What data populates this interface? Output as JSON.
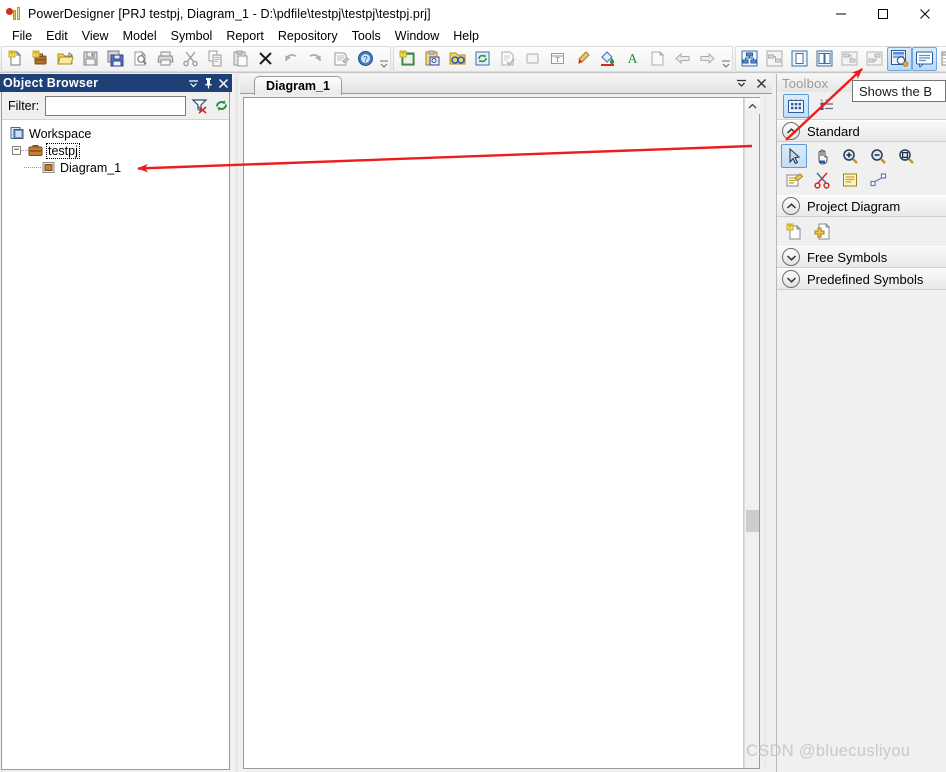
{
  "window": {
    "title": "PowerDesigner [PRJ testpj, Diagram_1 - D:\\pdfile\\testpj\\testpj\\testpj.prj]",
    "app_icon": "powerdesigner-icon",
    "controls": {
      "minimize": "minimize-icon",
      "maximize": "maximize-icon",
      "close": "close-icon"
    }
  },
  "menubar": {
    "items": [
      {
        "label": "File"
      },
      {
        "label": "Edit"
      },
      {
        "label": "View"
      },
      {
        "label": "Model"
      },
      {
        "label": "Symbol"
      },
      {
        "label": "Report"
      },
      {
        "label": "Repository"
      },
      {
        "label": "Tools"
      },
      {
        "label": "Window"
      },
      {
        "label": "Help"
      }
    ]
  },
  "toolbar": {
    "group1": [
      {
        "name": "new-icon"
      },
      {
        "name": "new-project-icon"
      },
      {
        "name": "open-icon"
      },
      {
        "name": "save-icon"
      },
      {
        "name": "save-all-icon"
      },
      {
        "name": "print-preview-icon"
      },
      {
        "name": "print-icon"
      },
      {
        "name": "cut-icon"
      },
      {
        "name": "copy-icon"
      },
      {
        "name": "paste-icon"
      },
      {
        "name": "delete-icon"
      },
      {
        "name": "undo-icon"
      },
      {
        "name": "redo-icon"
      },
      {
        "name": "properties-icon"
      },
      {
        "name": "help-icon"
      }
    ],
    "group2": [
      {
        "name": "new-diagram-icon"
      },
      {
        "name": "clipboard-model-icon"
      },
      {
        "name": "find-in-folder-icon"
      },
      {
        "name": "refresh-icon"
      },
      {
        "name": "check-model-icon"
      },
      {
        "name": "shape-icon"
      },
      {
        "name": "resize-icon"
      },
      {
        "name": "brush-icon"
      },
      {
        "name": "fill-color-icon"
      },
      {
        "name": "font-color-icon"
      },
      {
        "name": "page-icon"
      },
      {
        "name": "previous-icon"
      },
      {
        "name": "next-icon"
      }
    ],
    "group3": [
      {
        "name": "model-tree-icon"
      },
      {
        "name": "diagram-overview-icon"
      },
      {
        "name": "single-page-icon"
      },
      {
        "name": "two-page-icon"
      },
      {
        "name": "dependency-icon"
      },
      {
        "name": "impact-analysis-icon"
      },
      {
        "name": "browser-toggle-icon",
        "active": true
      },
      {
        "name": "output-toggle-icon",
        "active": true
      },
      {
        "name": "result-list-icon"
      }
    ]
  },
  "object_browser": {
    "title": "Object Browser",
    "title_buttons": [
      {
        "name": "dropdown-menu-icon"
      },
      {
        "name": "pin-icon"
      },
      {
        "name": "close-panel-icon"
      }
    ],
    "filter": {
      "label": "Filter:",
      "value": "",
      "placeholder": "",
      "clear_button": "clear-filter-icon",
      "refresh_button": "refresh-filter-icon"
    },
    "tree": {
      "root": {
        "label": "Workspace",
        "icon": "workspace-icon"
      },
      "project": {
        "label": "testpj",
        "icon": "briefcase-icon",
        "expanded": true,
        "selected": true
      },
      "diagram": {
        "label": "Diagram_1",
        "icon": "diagram-icon"
      }
    }
  },
  "mdi": {
    "tab": {
      "label": "Diagram_1",
      "active": true
    },
    "tab_actions": [
      {
        "name": "tab-list-icon"
      },
      {
        "name": "close-document-icon"
      }
    ],
    "scrollbar": {
      "up_arrow": "scroll-up-icon"
    }
  },
  "toolbox": {
    "title": "Toolbox",
    "top_tools": [
      {
        "name": "grid-palette-icon",
        "selected": true
      },
      {
        "name": "list-palette-icon",
        "selected": false
      }
    ],
    "sections": [
      {
        "label": "Standard",
        "expanded": true,
        "chevron": "chevron-up-icon",
        "tools": [
          {
            "name": "pointer-tool-icon",
            "selected": true
          },
          {
            "name": "grabber-hand-tool-icon",
            "selected": false
          },
          {
            "name": "zoom-in-tool-icon",
            "selected": false
          },
          {
            "name": "zoom-out-tool-icon",
            "selected": false
          },
          {
            "name": "zoom-fit-tool-icon",
            "selected": false
          },
          {
            "name": "properties-tool-icon",
            "selected": false
          },
          {
            "name": "delete-scissors-tool-icon",
            "selected": false
          },
          {
            "name": "note-tool-icon",
            "selected": false
          },
          {
            "name": "link-tool-icon",
            "selected": false
          }
        ]
      },
      {
        "label": "Project Diagram",
        "expanded": true,
        "chevron": "chevron-up-icon",
        "tools": [
          {
            "name": "new-model-tool-icon",
            "selected": false
          },
          {
            "name": "add-document-tool-icon",
            "selected": false
          }
        ]
      },
      {
        "label": "Free Symbols",
        "expanded": false,
        "chevron": "chevron-down-icon",
        "tools": []
      },
      {
        "label": "Predefined Symbols",
        "expanded": false,
        "chevron": "chevron-down-icon",
        "tools": []
      }
    ]
  },
  "tooltip": {
    "text": "Shows the B"
  },
  "annotations": {
    "arrow_to_diagram": {
      "color": "#ee1c1c"
    },
    "arrow_to_toolbar_button": {
      "color": "#ee1c1c"
    }
  },
  "watermark": {
    "text": "CSDN @bluecusliyou",
    "color": "#c9c9c9"
  }
}
